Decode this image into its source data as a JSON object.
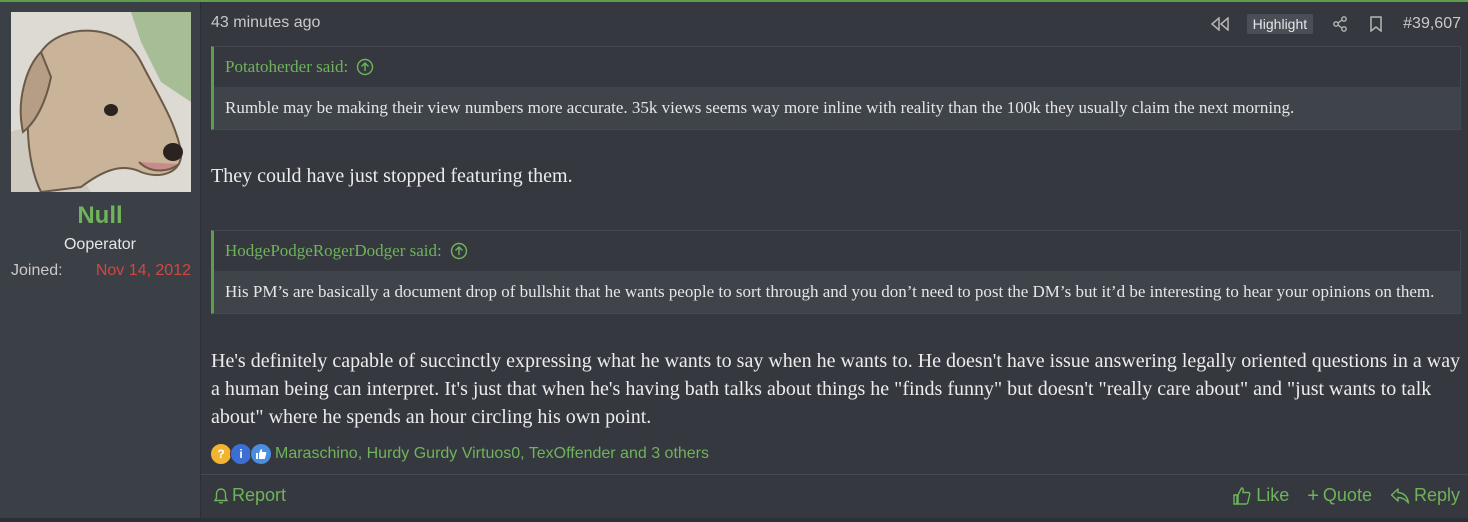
{
  "user": {
    "name": "Null",
    "title": "Ooperator",
    "joined_label": "Joined:",
    "joined_value": "Nov 14, 2012"
  },
  "header": {
    "time": "43 minutes ago",
    "highlight_label": "Highlight",
    "post_number": "#39,607"
  },
  "quotes": [
    {
      "author": "Potatoherder said:",
      "text": "Rumble may be making their view numbers more accurate. 35k views seems way more inline with reality than the 100k they usually claim the next morning."
    },
    {
      "author": "HodgePodgeRogerDodger said:",
      "text": "His PM’s are basically a document drop of bullshit that he wants people to sort through and you don’t need to post the DM’s but it’d be interesting to hear your opinions on them."
    }
  ],
  "messages": [
    "They could have just stopped featuring them.",
    "He's definitely capable of succinctly expressing what he wants to say when he wants to. He doesn't have issue answering legally oriented questions in a way a human being can interpret. It's just that when he's having bath talks about things he \"finds funny\" but doesn't \"really care about\" and \"just wants to talk about\" where he spends an hour circling his own point."
  ],
  "reactions": {
    "icons": [
      "thinking-reaction-icon",
      "informative-reaction-icon",
      "like-reaction-icon"
    ],
    "text": "Maraschino, Hurdy Gurdy Virtuos0, TexOffender and 3 others"
  },
  "footer": {
    "report": "Report",
    "like": "Like",
    "quote": "Quote",
    "reply": "Reply"
  },
  "colors": {
    "accent": "#6fb35a",
    "joined": "#d2473f",
    "background": "#35383f"
  }
}
